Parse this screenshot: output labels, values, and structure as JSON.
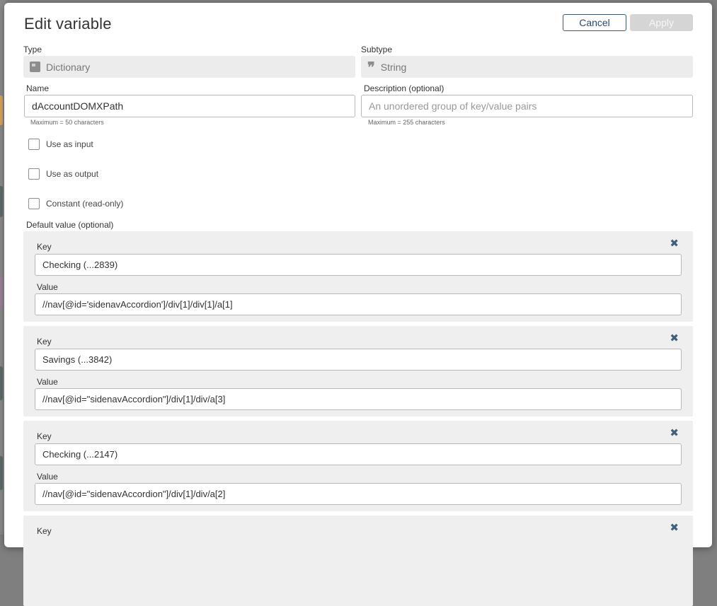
{
  "dialog": {
    "title": "Edit variable",
    "cancel_label": "Cancel",
    "apply_label": "Apply"
  },
  "type": {
    "label": "Type",
    "value": "Dictionary",
    "icon": "dictionary-icon"
  },
  "subtype": {
    "label": "Subtype",
    "value": "String",
    "icon": "quote-icon"
  },
  "name": {
    "label": "Name",
    "value": "dAccountDOMXPath",
    "hint": "Maximum = 50 characters"
  },
  "description": {
    "label": "Description (optional)",
    "placeholder": "An unordered group of key/value pairs",
    "hint": "Maximum = 255 characters"
  },
  "checkboxes": [
    {
      "label": "Use as input",
      "checked": false
    },
    {
      "label": "Use as output",
      "checked": false
    },
    {
      "label": "Constant (read-only)",
      "checked": false
    }
  ],
  "default_value": {
    "label": "Default value (optional)",
    "key_label": "Key",
    "value_label": "Value",
    "pairs": [
      {
        "key": "Checking (...2839)",
        "value": "//nav[@id='sidenavAccordion']/div[1]/div[1]/a[1]"
      },
      {
        "key": "Savings (...3842)",
        "value": "//nav[@id=\"sidenavAccordion\"]/div[1]/div/a[3]"
      },
      {
        "key": "Checking (...2147)",
        "value": "//nav[@id=\"sidenavAccordion\"]/div[1]/div/a[2]"
      },
      {
        "key": "",
        "value": ""
      }
    ]
  },
  "colors": {
    "accent": "#3e5f80",
    "field_bg": "#ececec",
    "pair_bg": "#efefef"
  }
}
